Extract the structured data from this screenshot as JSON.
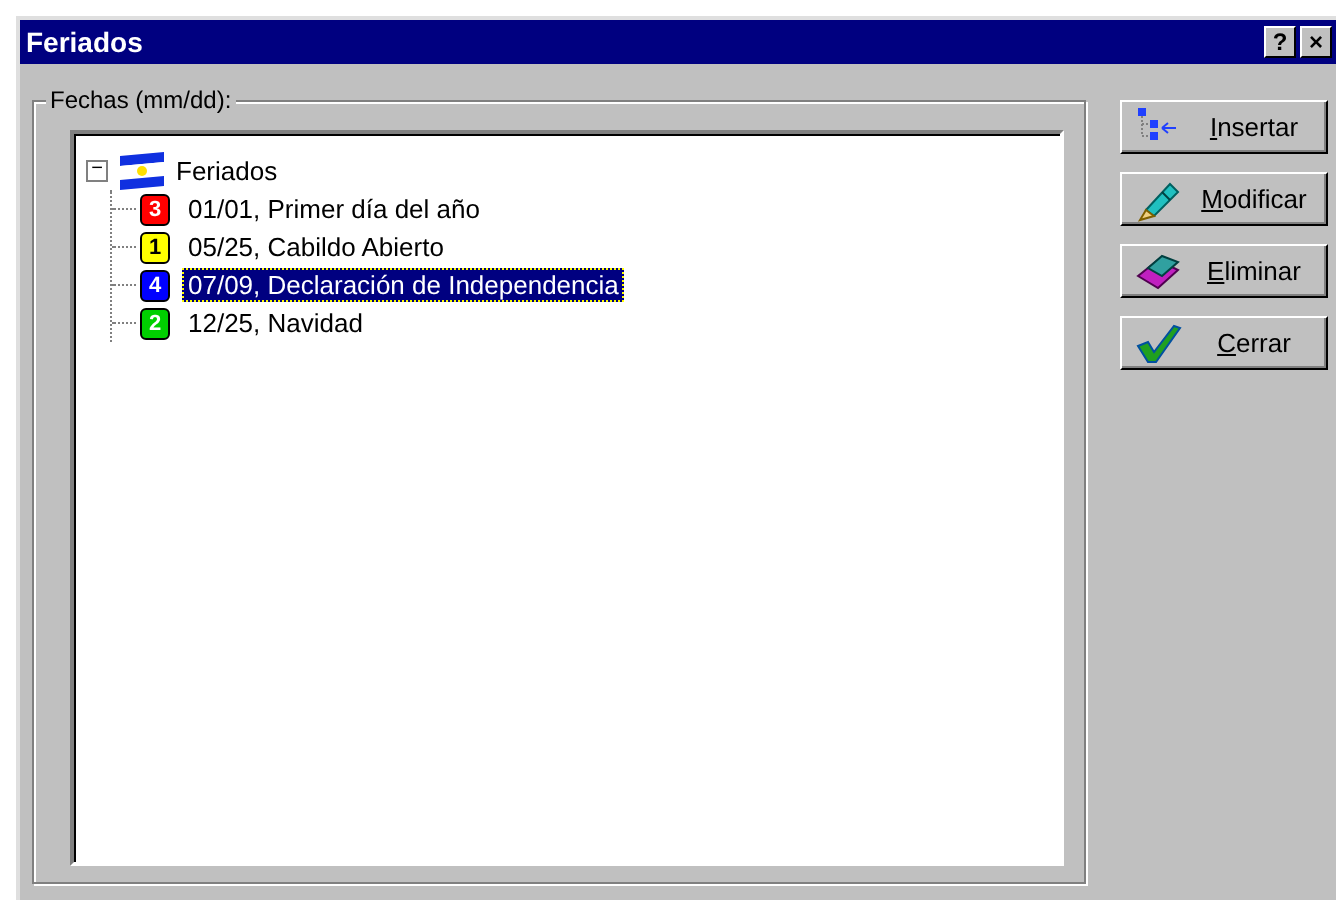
{
  "window": {
    "title": "Feriados",
    "title_buttons": [
      "?",
      "×"
    ]
  },
  "group": {
    "label": "Fechas (mm/dd):"
  },
  "tree": {
    "label": "Feriados",
    "expanded": true,
    "toggle": "−",
    "children": [
      {
        "badge": "3",
        "color": "#ff0000",
        "label": "01/01, Primer día del año",
        "selected": false
      },
      {
        "badge": "1",
        "color": "#ffff00",
        "label": "05/25, Cabildo Abierto",
        "selected": false
      },
      {
        "badge": "4",
        "color": "#0000ff",
        "label": "07/09, Declaración de Independencia",
        "selected": true
      },
      {
        "badge": "2",
        "color": "#00d000",
        "label": "12/25, Navidad",
        "selected": false
      }
    ]
  },
  "buttons": [
    {
      "kind": "insert",
      "label": "Insertar",
      "underline_first": true
    },
    {
      "kind": "edit",
      "label": "Modificar",
      "underline_first": true
    },
    {
      "kind": "delete",
      "label": "Eliminar",
      "underline_first": true
    },
    {
      "kind": "close",
      "label": "Cerrar",
      "underline_first": true
    }
  ]
}
